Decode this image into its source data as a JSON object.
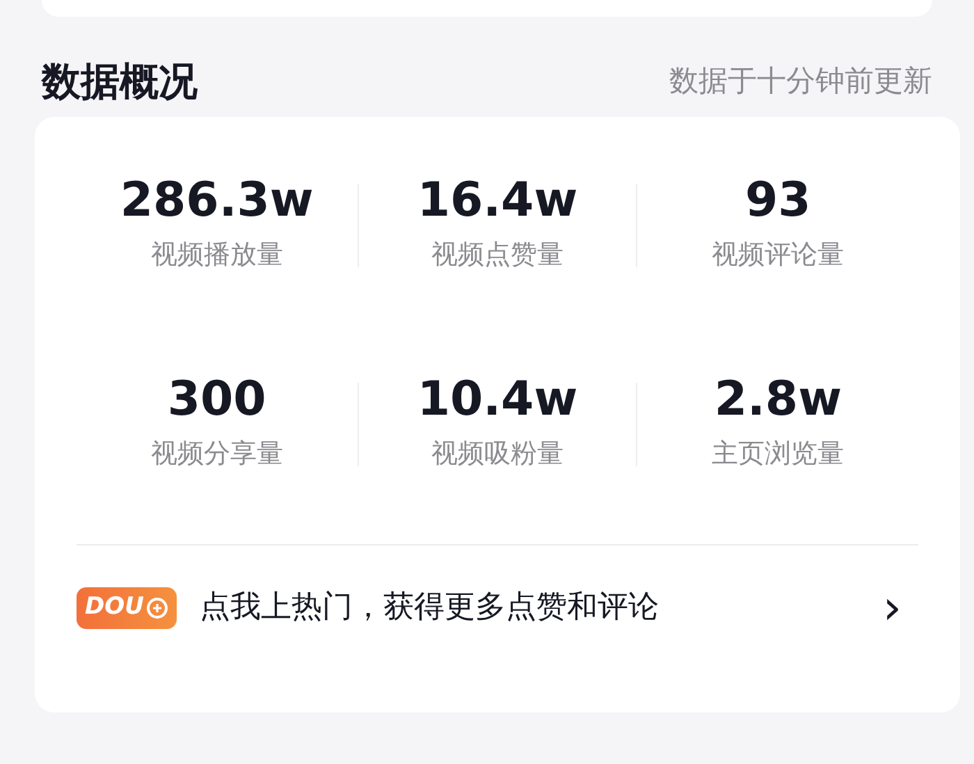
{
  "header": {
    "title": "数据概况",
    "update_note": "数据于十分钟前更新"
  },
  "stats": [
    {
      "value": "286.3w",
      "label": "视频播放量"
    },
    {
      "value": "16.4w",
      "label": "视频点赞量"
    },
    {
      "value": "93",
      "label": "视频评论量"
    },
    {
      "value": "300",
      "label": "视频分享量"
    },
    {
      "value": "10.4w",
      "label": "视频吸粉量"
    },
    {
      "value": "2.8w",
      "label": "主页浏览量"
    }
  ],
  "promo": {
    "badge": "DOU",
    "text": "点我上热门，获得更多点赞和评论",
    "chevron": "›"
  }
}
